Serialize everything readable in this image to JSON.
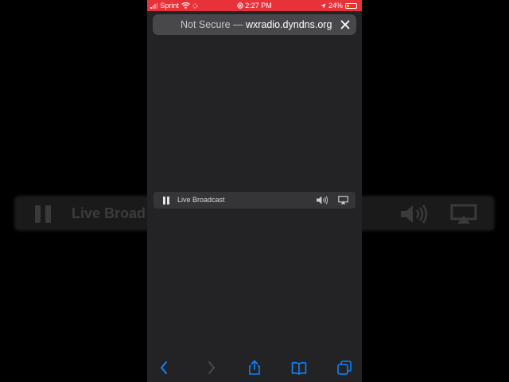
{
  "status_bar": {
    "carrier": "Sprint",
    "time": "2:27 PM",
    "battery": "24%",
    "battery_level": 0.24
  },
  "address_bar": {
    "security": "Not Secure —",
    "domain": "wxradio.dyndns.org"
  },
  "player": {
    "label": "Live Broadcast",
    "background_label": "Live Broad"
  },
  "toolbar": {
    "icons": [
      "back-icon",
      "forward-icon",
      "share-icon",
      "bookmarks-icon",
      "tabs-icon"
    ]
  },
  "colors": {
    "status_bar": "#e8323a",
    "accent": "#0a84ff",
    "page_background": "#232325"
  }
}
